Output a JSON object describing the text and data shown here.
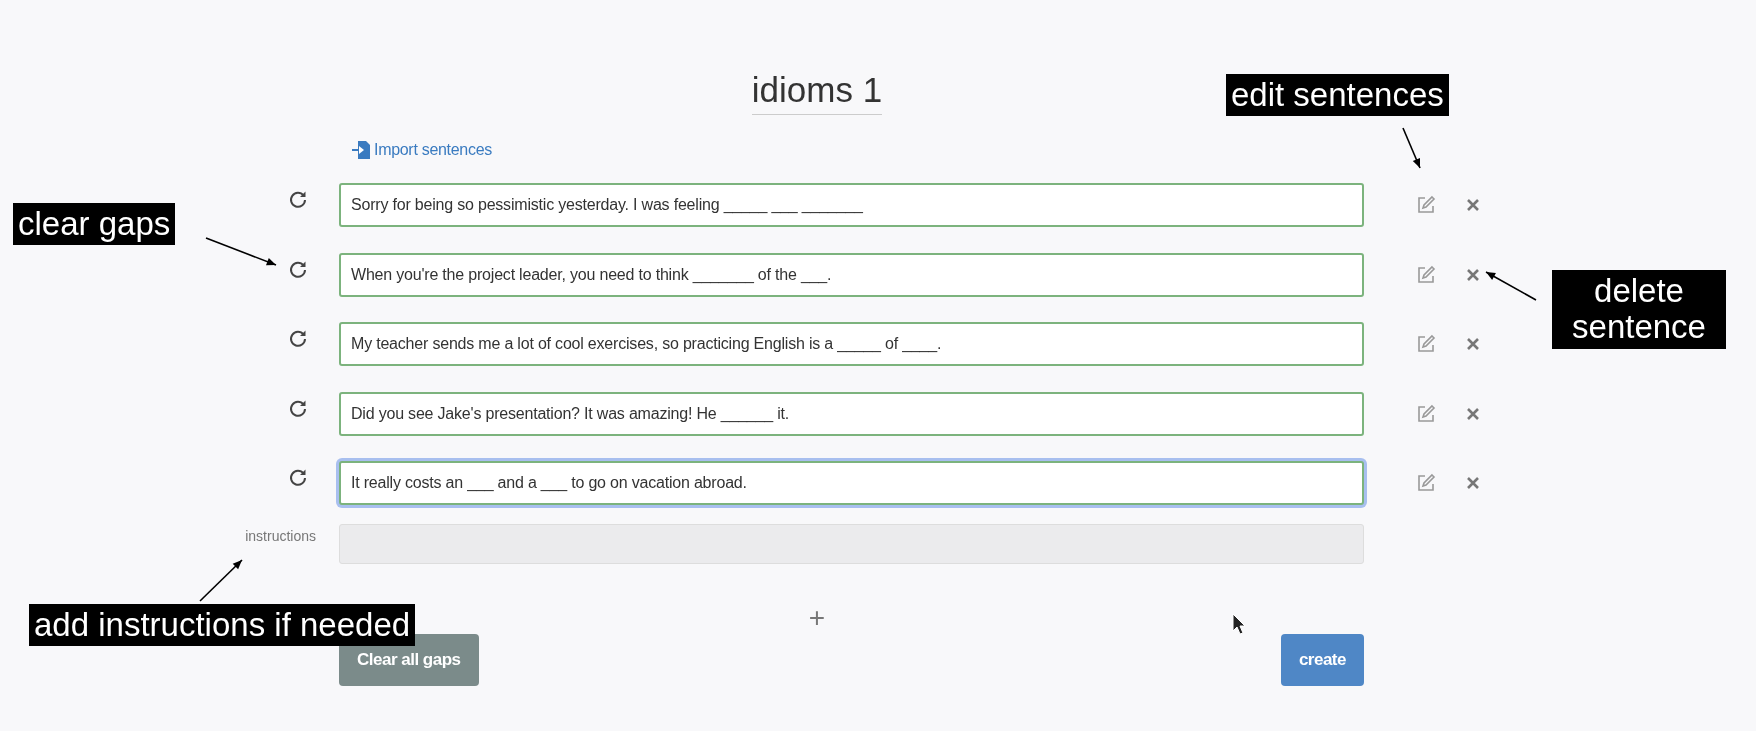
{
  "title": "idioms 1",
  "import_link": "Import sentences",
  "sentences": [
    {
      "text": "Sorry for being so pessimistic yesterday. I was feeling _____ ___ _______",
      "focused": false
    },
    {
      "text": "When you're the project leader, you need to think _______ of the ___.",
      "focused": false
    },
    {
      "text": "My teacher sends me a lot of cool exercises, so practicing English is a _____ of ____.",
      "focused": false
    },
    {
      "text": "Did you see Jake's presentation? It was amazing! He ______ it.",
      "focused": false
    },
    {
      "text": "It really costs an ___ and a ___ to go on vacation abroad.",
      "focused": true
    }
  ],
  "instructions": {
    "label": "instructions"
  },
  "add_button": "+",
  "buttons": [
    {
      "label": "Clear all gaps",
      "kind": "secondary"
    },
    {
      "label": "create",
      "kind": "primary"
    }
  ],
  "annotations": [
    {
      "text": "edit sentences",
      "kind": "edit"
    },
    {
      "text": "clear gaps",
      "kind": "clear"
    },
    {
      "text": "delete sentence",
      "kind": "delete"
    },
    {
      "text": "add instructions if needed",
      "kind": "instructions"
    }
  ]
}
